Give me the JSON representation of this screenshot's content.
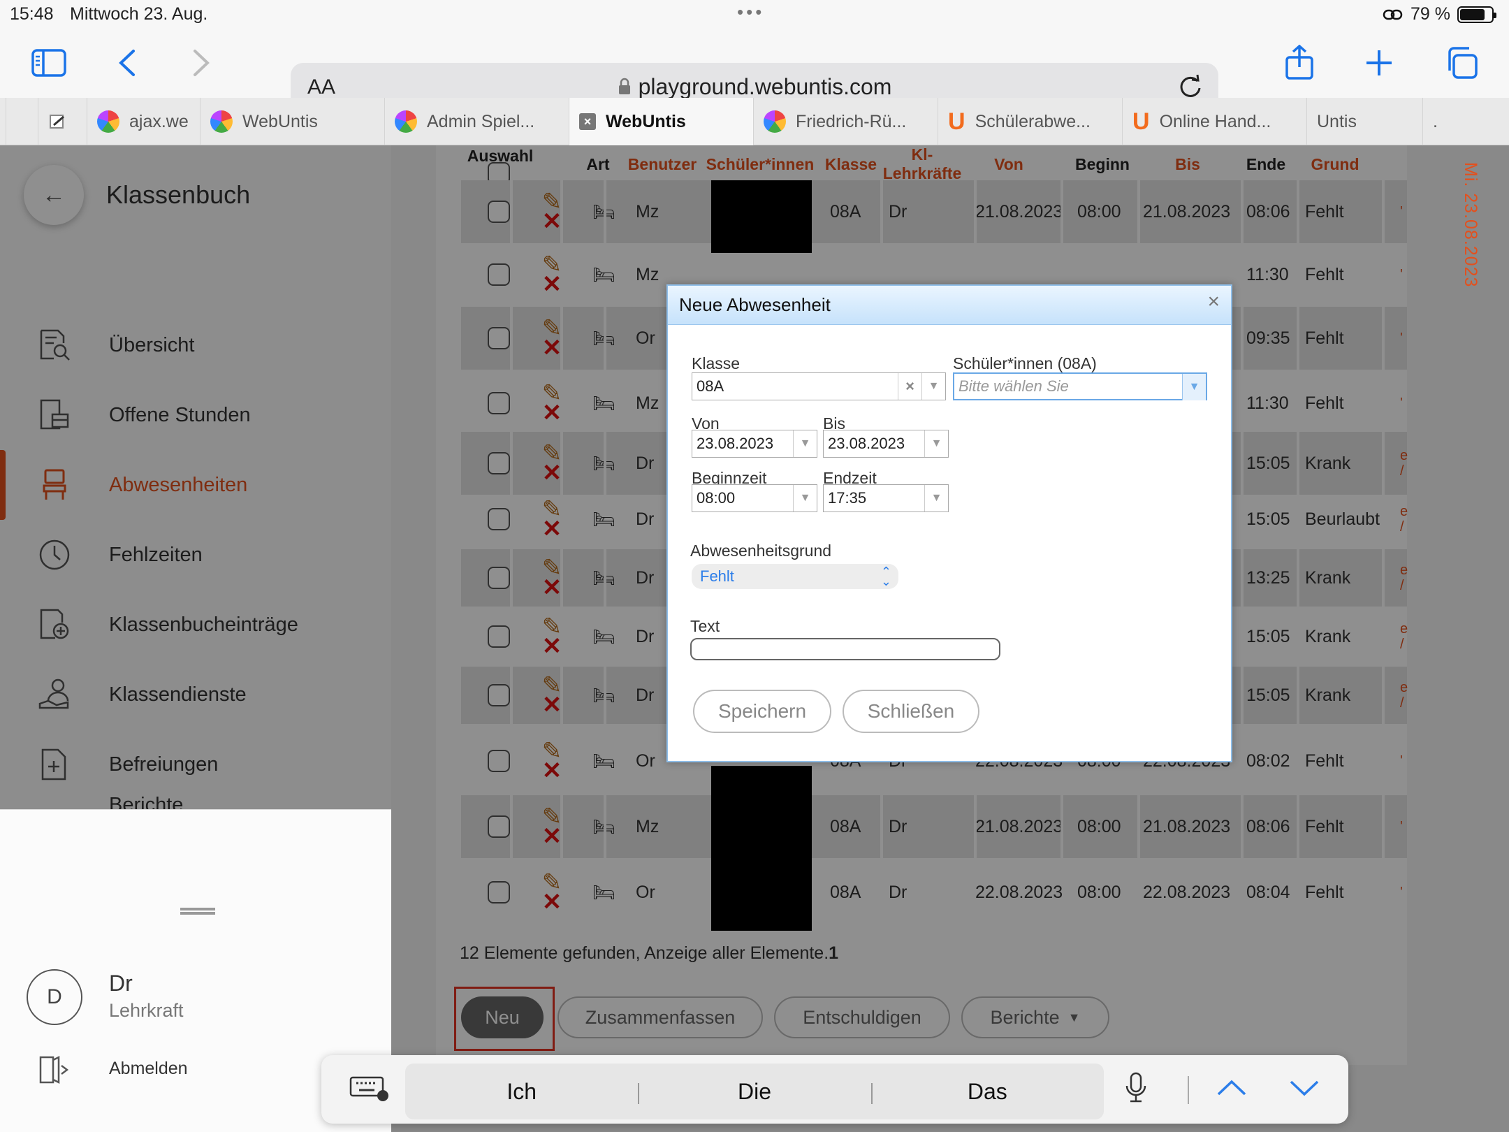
{
  "status": {
    "time": "15:48",
    "date": "Mittwoch 23. Aug.",
    "battery": "79 %"
  },
  "browser": {
    "aa": "AA",
    "url": "playground.webuntis.com",
    "tabs": [
      {
        "label": "ajax.we",
        "icon": "webuntis-favicon"
      },
      {
        "label": "WebUntis",
        "icon": "webuntis-favicon"
      },
      {
        "label": "Admin Spiel...",
        "icon": "webuntis-favicon"
      },
      {
        "label": "WebUntis",
        "icon": "close-icon",
        "active": true
      },
      {
        "label": "Friedrich-Rü...",
        "icon": "webuntis-favicon"
      },
      {
        "label": "Schülerabwe...",
        "icon": "untis-u-icon"
      },
      {
        "label": "Online Hand...",
        "icon": "untis-u-icon"
      },
      {
        "label": "Untis",
        "icon": ""
      }
    ],
    "tab_more": "."
  },
  "sidebar": {
    "title": "Klassenbuch",
    "items": [
      {
        "label": "Übersicht",
        "icon": "overview-icon"
      },
      {
        "label": "Offene Stunden",
        "icon": "open-lessons-icon"
      },
      {
        "label": "Abwesenheiten",
        "icon": "chair-icon",
        "active": true
      },
      {
        "label": "Fehlzeiten",
        "icon": "clock-icon"
      },
      {
        "label": "Klassenbucheinträge",
        "icon": "add-entry-icon"
      },
      {
        "label": "Klassendienste",
        "icon": "class-duty-icon"
      },
      {
        "label": "Befreiungen",
        "icon": "exemption-icon"
      },
      {
        "label": "Berichte",
        "icon": "reports-icon"
      }
    ],
    "user": {
      "initial": "D",
      "name": "Dr",
      "role": "Lehrkraft",
      "logout": "Abmelden"
    }
  },
  "table": {
    "headers": {
      "auswahl": "Auswahl",
      "art": "Art",
      "benutzer": "Benutzer",
      "schueler": "Schüler*innen",
      "klasse": "Klasse",
      "kl1": "Kl-",
      "kl2": "Lehrkräfte",
      "von": "Von",
      "beginn": "Beginn",
      "bis": "Bis",
      "ende": "Ende",
      "grund": "Grund"
    },
    "rows": [
      {
        "user": "Mz",
        "klasse": "08A",
        "kl": "Dr",
        "von": "21.08.2023",
        "beginn": "08:00",
        "bis": "21.08.2023",
        "ende": "08:06",
        "grund": "Fehlt",
        "mark": "'"
      },
      {
        "user": "Mz",
        "klasse": "",
        "kl": "",
        "von": "",
        "beginn": "",
        "bis": "",
        "ende": "11:30",
        "grund": "Fehlt",
        "mark": "'"
      },
      {
        "user": "Or",
        "klasse": "",
        "kl": "",
        "von": "",
        "beginn": "",
        "bis": "",
        "ende": "09:35",
        "grund": "Fehlt",
        "mark": "'"
      },
      {
        "user": "Mz",
        "klasse": "",
        "kl": "",
        "von": "",
        "beginn": "",
        "bis": "",
        "ende": "11:30",
        "grund": "Fehlt",
        "mark": "'"
      },
      {
        "user": "Dr",
        "klasse": "",
        "kl": "",
        "von": "",
        "beginn": "",
        "bis": "",
        "ende": "15:05",
        "grund": "Krank",
        "mark": "e /"
      },
      {
        "user": "Dr",
        "klasse": "",
        "kl": "",
        "von": "",
        "beginn": "",
        "bis": "",
        "ende": "15:05",
        "grund": "Beurlaubt",
        "mark": "e /"
      },
      {
        "user": "Dr",
        "klasse": "",
        "kl": "",
        "von": "",
        "beginn": "",
        "bis": "",
        "ende": "13:25",
        "grund": "Krank",
        "mark": "e /"
      },
      {
        "user": "Dr",
        "klasse": "",
        "kl": "",
        "von": "",
        "beginn": "",
        "bis": "",
        "ende": "15:05",
        "grund": "Krank",
        "mark": "e /"
      },
      {
        "user": "Dr",
        "klasse": "",
        "kl": "",
        "von": "",
        "beginn": "",
        "bis": "",
        "ende": "15:05",
        "grund": "Krank",
        "mark": "e /"
      },
      {
        "user": "Or",
        "klasse": "08A",
        "kl": "Dr",
        "von": "22.08.2023",
        "beginn": "08:00",
        "bis": "22.08.2023",
        "ende": "08:02",
        "grund": "Fehlt",
        "mark": "'"
      },
      {
        "user": "Mz",
        "klasse": "08A",
        "kl": "Dr",
        "von": "21.08.2023",
        "beginn": "08:00",
        "bis": "21.08.2023",
        "ende": "08:06",
        "grund": "Fehlt",
        "mark": "'"
      },
      {
        "user": "Or",
        "klasse": "08A",
        "kl": "Dr",
        "von": "22.08.2023",
        "beginn": "08:00",
        "bis": "22.08.2023",
        "ende": "08:04",
        "grund": "Fehlt",
        "mark": "'"
      }
    ],
    "count_text": "12 Elemente gefunden, Anzeige aller Elemente.",
    "page": "1"
  },
  "actions": {
    "neu": "Neu",
    "zusammenfassen": "Zusammenfassen",
    "entschuldigen": "Entschuldigen",
    "berichte": "Berichte"
  },
  "right_date": "Mi. 23.08.2023",
  "dialog": {
    "title": "Neue Abwesenheit",
    "close": "×",
    "klasse_label": "Klasse",
    "klasse_value": "08A",
    "schueler_label": "Schüler*innen (08A)",
    "schueler_placeholder": "Bitte wählen Sie",
    "von_label": "Von",
    "von_value": "23.08.2023",
    "bis_label": "Bis",
    "bis_value": "23.08.2023",
    "beginn_label": "Beginnzeit",
    "beginn_value": "08:00",
    "end_label": "Endzeit",
    "end_value": "17:35",
    "grund_label": "Abwesenheitsgrund",
    "grund_value": "Fehlt",
    "text_label": "Text",
    "text_value": "",
    "save": "Speichern",
    "close_btn": "Schließen"
  },
  "keyboard": {
    "suggestions": [
      "Ich",
      "Die",
      "Das"
    ]
  },
  "colors": {
    "accent": "#e3501d",
    "link": "#2b7de9",
    "highlight": "#e53222"
  }
}
